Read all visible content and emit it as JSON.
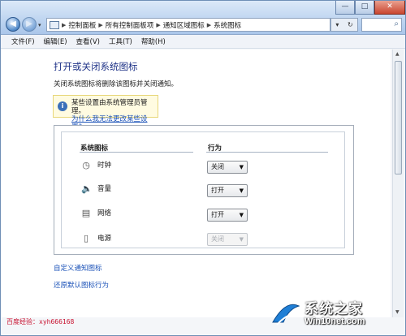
{
  "window": {
    "breadcrumbs": [
      "控制面板",
      "所有控制面板项",
      "通知区域图标",
      "系统图标"
    ],
    "nav": {
      "back": "◀",
      "forward": "▶"
    },
    "controls": {
      "minimize": "—",
      "maximize": "□",
      "close": "✕"
    }
  },
  "menu": [
    "文件(F)",
    "编辑(E)",
    "查看(V)",
    "工具(T)",
    "帮助(H)"
  ],
  "page": {
    "title": "打开或关闭系统图标",
    "subtitle": "关闭系统图标将删除该图标并关闭通知。",
    "notice_text": "某些设置由系统管理员管理。",
    "notice_link": "为什么我无法更改某些设置?"
  },
  "table": {
    "col_icon": "系统图标",
    "col_behavior": "行为",
    "rows": [
      {
        "icon": "clock-icon",
        "label": "时钟",
        "value": "关闭",
        "disabled": false
      },
      {
        "icon": "volume-icon",
        "label": "音量",
        "value": "打开",
        "disabled": false
      },
      {
        "icon": "network-icon",
        "label": "网络",
        "value": "打开",
        "disabled": false
      },
      {
        "icon": "power-icon",
        "label": "电源",
        "value": "关闭",
        "disabled": true
      }
    ]
  },
  "links": {
    "customize": "自定义通知图标",
    "restore": "还原默认图标行为"
  },
  "watermark": "百度经验：xyh666168",
  "brand": {
    "name": "系统之家",
    "url": "Win10net.com"
  }
}
